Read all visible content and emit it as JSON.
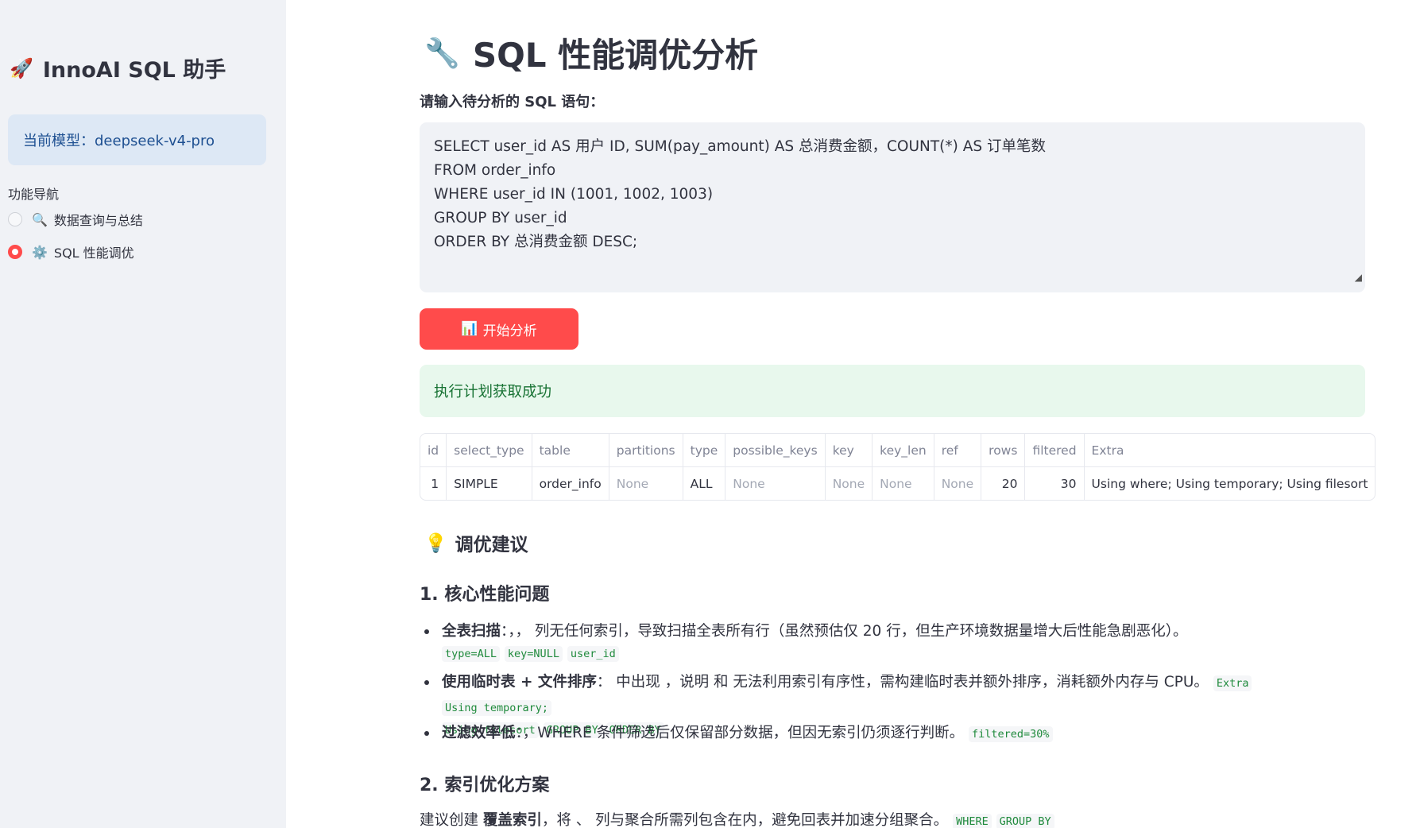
{
  "sidebar": {
    "app_icon": "🚀",
    "app_title": "InnoAI SQL 助手",
    "model_info": "当前模型：deepseek-v4-pro",
    "nav_label": "功能导航",
    "nav_items": [
      {
        "icon": "🔍",
        "label": "数据查询与总结",
        "selected": false
      },
      {
        "icon": "⚙️",
        "label": "SQL 性能调优",
        "selected": true
      }
    ]
  },
  "main": {
    "title_icon": "🔧",
    "title": "SQL 性能调优分析",
    "input_label": "请输入待分析的 SQL 语句：",
    "sql_lines": [
      "SELECT user_id AS 用户 ID, SUM(pay_amount) AS 总消费金额，COUNT(*) AS 订单笔数",
      "FROM order_info",
      "WHERE user_id IN (1001, 1002, 1003)",
      "GROUP BY user_id",
      "ORDER BY 总消费金额 DESC;"
    ],
    "run_button_icon": "📊",
    "run_button_label": "开始分析",
    "success_message": "执行计划获取成功",
    "plan_table": {
      "columns": [
        "id",
        "select_type",
        "table",
        "partitions",
        "type",
        "possible_keys",
        "key",
        "key_len",
        "ref",
        "rows",
        "filtered",
        "Extra"
      ],
      "rows": [
        [
          "1",
          "SIMPLE",
          "order_info",
          "None",
          "ALL",
          "None",
          "None",
          "None",
          "None",
          "20",
          "30",
          "Using where; Using temporary; Using filesort"
        ]
      ]
    },
    "tuning": {
      "heading_icon": "💡",
      "heading": "调优建议",
      "section1_title": "1. 核心性能问题",
      "bullets": [
        {
          "bold": "全表扫描",
          "text": "：，，  列无任何索引，导致扫描全表所有行（虽然预估仅 20 行，但生产环境数据量增大后性能急剧恶化）。",
          "codes": [
            "type=ALL",
            "key=NULL",
            "user_id"
          ]
        },
        {
          "bold": "使用临时表 + 文件排序",
          "text": "：  中出现  ，说明  和  无法利用索引有序性，需构建临时表并额外排序，消耗额外内存与 CPU。",
          "codes": [
            "Extra",
            "Using temporary;",
            "Using filesort",
            "GROUP BY",
            "ORDER BY"
          ]
        },
        {
          "bold": "过滤效率低",
          "text": "：，WHERE 条件筛选后仅保留部分数据，但因无索引仍须逐行判断。",
          "codes": [
            "filtered=30%"
          ]
        }
      ],
      "section2_title": "2. 索引优化方案",
      "section2_bold": "覆盖索引",
      "section2_pre": "建议创建 ",
      "section2_post": "，将  、  列与聚合所需列包含在内，避免回表并加速分组聚合。",
      "section2_codes": [
        "WHERE",
        "GROUP BY"
      ]
    }
  }
}
